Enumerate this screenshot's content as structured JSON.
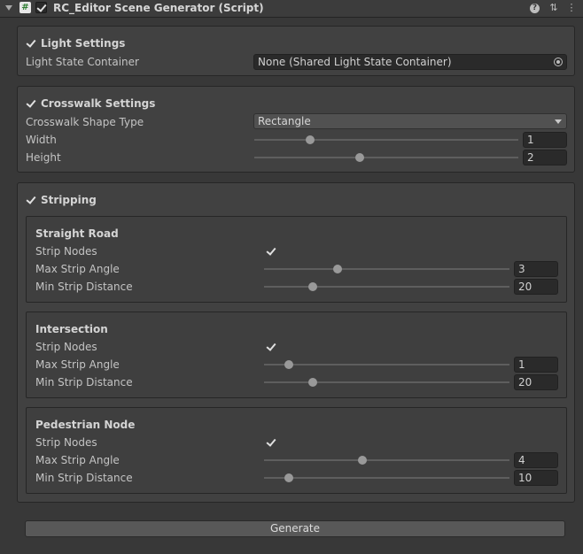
{
  "header": {
    "title": "RC_Editor Scene Generator (Script)",
    "script_icon_glyph": "#",
    "help_glyph": "?",
    "presets_glyph": "⇅",
    "menu_glyph": "⋮"
  },
  "light": {
    "title": "Light Settings",
    "enabled": true,
    "container_label": "Light State Container",
    "container_value": "None (Shared Light State Container)"
  },
  "crosswalk": {
    "title": "Crosswalk Settings",
    "enabled": true,
    "shape_label": "Crosswalk Shape Type",
    "shape_value": "Rectangle",
    "width_label": "Width",
    "width_value": "1",
    "width_fraction": 0.21,
    "height_label": "Height",
    "height_value": "2",
    "height_fraction": 0.4
  },
  "stripping": {
    "title": "Stripping",
    "enabled": true,
    "groups": [
      {
        "title": "Straight Road",
        "strip_nodes_label": "Strip Nodes",
        "strip_nodes": true,
        "angle_label": "Max Strip Angle",
        "angle_value": "3",
        "angle_fraction": 0.3,
        "distance_label": "Min Strip Distance",
        "distance_value": "20",
        "distance_fraction": 0.2
      },
      {
        "title": "Intersection",
        "strip_nodes_label": "Strip Nodes",
        "strip_nodes": true,
        "angle_label": "Max Strip Angle",
        "angle_value": "1",
        "angle_fraction": 0.1,
        "distance_label": "Min Strip Distance",
        "distance_value": "20",
        "distance_fraction": 0.2
      },
      {
        "title": "Pedestrian Node",
        "strip_nodes_label": "Strip Nodes",
        "strip_nodes": true,
        "angle_label": "Max Strip Angle",
        "angle_value": "4",
        "angle_fraction": 0.4,
        "distance_label": "Min Strip Distance",
        "distance_value": "10",
        "distance_fraction": 0.1
      }
    ]
  },
  "generate_label": "Generate",
  "colors": {
    "background": "#383838",
    "panel": "#414141",
    "field": "#2a2a2a",
    "slider_thumb": "#999999"
  }
}
